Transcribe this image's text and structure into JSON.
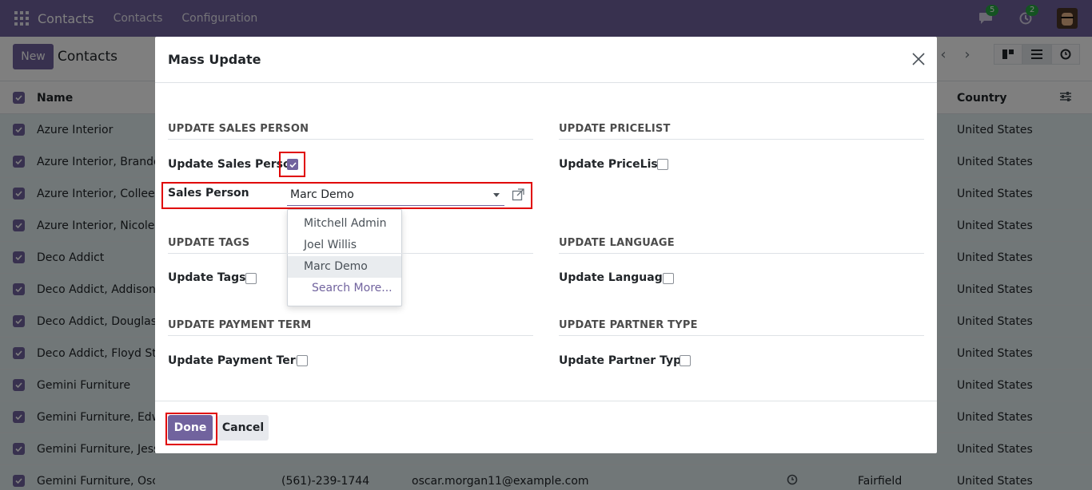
{
  "navbar": {
    "brand": "Contacts",
    "links": [
      "Contacts",
      "Configuration"
    ],
    "messages_count": "5",
    "activities_count": "2"
  },
  "control_panel": {
    "new_label": "New",
    "breadcrumb": "Contacts"
  },
  "list": {
    "headers": {
      "name": "Name",
      "country": "Country"
    },
    "rows": [
      {
        "name": "Azure Interior",
        "country": "United States"
      },
      {
        "name": "Azure Interior, Brandon",
        "country": "United States"
      },
      {
        "name": "Azure Interior, Colleen D",
        "country": "United States"
      },
      {
        "name": "Azure Interior, Nicole Fo",
        "country": "United States"
      },
      {
        "name": "Deco Addict",
        "country": "United States"
      },
      {
        "name": "Deco Addict, Addison O",
        "country": "United States"
      },
      {
        "name": "Deco Addict, Douglas Fl",
        "country": "United States"
      },
      {
        "name": "Deco Addict, Floyd Stev",
        "country": "United States"
      },
      {
        "name": "Gemini Furniture",
        "country": "United States"
      },
      {
        "name": "Gemini Furniture, Edwin",
        "country": "United States"
      },
      {
        "name": "Gemini Furniture, Jesse",
        "country": "United States"
      },
      {
        "name": "Gemini Furniture, Oscar Morgan",
        "phone": "(561)-239-1744",
        "email": "oscar.morgan11@example.com",
        "city": "Fairfield",
        "country": "United States"
      }
    ]
  },
  "modal": {
    "title": "Mass Update",
    "sections": {
      "sales_person": {
        "title": "UPDATE SALES PERSON",
        "toggle_label": "Update Sales Person",
        "checked": true,
        "field_label": "Sales Person",
        "field_value": "Marc Demo",
        "dropdown": [
          "Mitchell Admin",
          "Joel Willis",
          "Marc Demo"
        ],
        "dropdown_active": "Marc Demo",
        "search_more": "Search More..."
      },
      "pricelist": {
        "title": "UPDATE PRICELIST",
        "toggle_label": "Update PriceList"
      },
      "tags": {
        "title": "UPDATE TAGS",
        "toggle_label": "Update Tags"
      },
      "language": {
        "title": "UPDATE LANGUAGE",
        "toggle_label": "Update Language"
      },
      "payment_term": {
        "title": "UPDATE PAYMENT TERM",
        "toggle_label": "Update Payment Term"
      },
      "partner_type": {
        "title": "UPDATE PARTNER TYPE",
        "toggle_label": "Update Partner Type"
      }
    },
    "done_label": "Done",
    "cancel_label": "Cancel"
  },
  "colors": {
    "brand": "#71639e",
    "highlight": "#e00000",
    "row_selected": "#e3eef0"
  }
}
